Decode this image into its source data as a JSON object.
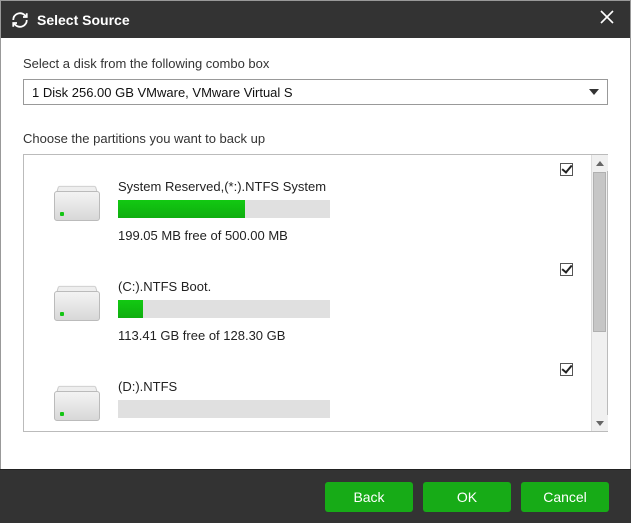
{
  "window": {
    "title": "Select Source"
  },
  "disk_select": {
    "label": "Select a disk from the following combo box",
    "selected": "1 Disk 256.00 GB VMware,  VMware Virtual S"
  },
  "partitions_label": "Choose the partitions you want to back up",
  "partitions": [
    {
      "name": "System Reserved,(*:).NTFS System",
      "free_text": "199.05 MB free of 500.00 MB",
      "checked": true,
      "fill_percent": 60
    },
    {
      "name": "(C:).NTFS Boot.",
      "free_text": "113.41 GB free of 128.30 GB",
      "checked": true,
      "fill_percent": 12
    },
    {
      "name": "(D:).NTFS",
      "free_text": "",
      "checked": true,
      "fill_percent": 0
    }
  ],
  "buttons": {
    "back": "Back",
    "ok": "OK",
    "cancel": "Cancel"
  }
}
